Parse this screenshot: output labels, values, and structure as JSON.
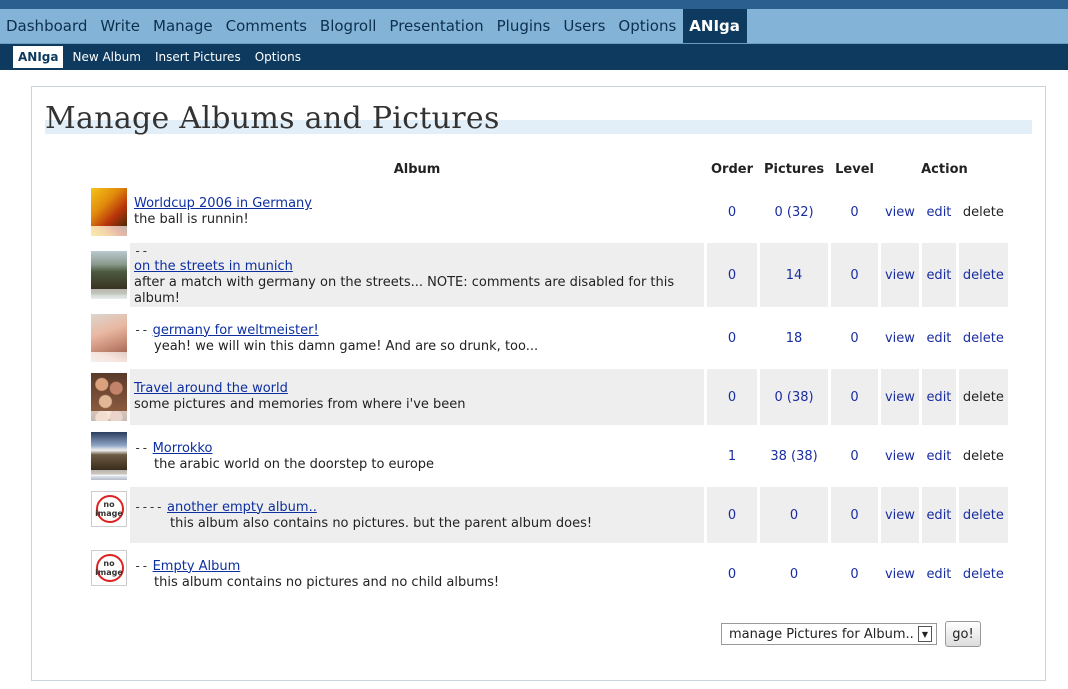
{
  "nav": {
    "main": [
      "Dashboard",
      "Write",
      "Manage",
      "Comments",
      "Blogroll",
      "Presentation",
      "Plugins",
      "Users",
      "Options",
      "ANIga"
    ],
    "sub": [
      "ANIga",
      "New Album",
      "Insert Pictures",
      "Options"
    ]
  },
  "page": {
    "title": "Manage Albums and Pictures"
  },
  "table": {
    "headers": {
      "album": "Album",
      "order": "Order",
      "pictures": "Pictures",
      "level": "Level",
      "action": "Action"
    },
    "rows": [
      {
        "prefix": "",
        "name": "Worldcup 2006 in Germany",
        "desc": "the ball is runnin!",
        "order": "0",
        "pictures": "0 (32)",
        "level": "0",
        "view": "view",
        "edit": "edit",
        "delete": "delete",
        "thumb": "football-photo"
      },
      {
        "prefix": "--",
        "name": "on the streets in munich",
        "desc": "after a match with germany on the streets... NOTE: comments are disabled for this album!",
        "order": "0",
        "pictures": "14",
        "level": "0",
        "view": "view",
        "edit": "edit",
        "delete": "delete",
        "thumb": "street-photo"
      },
      {
        "prefix": "--",
        "name": "germany for weltmeister!",
        "desc": "yeah! we will win this damn game! And are so drunk, too...",
        "order": "0",
        "pictures": "18",
        "level": "0",
        "view": "view",
        "edit": "edit",
        "delete": "delete",
        "thumb": "hand-photo"
      },
      {
        "prefix": "",
        "name": "Travel around the world",
        "desc": "some pictures and memories from where i've been",
        "order": "0",
        "pictures": "0 (38)",
        "level": "0",
        "view": "view",
        "edit": "edit",
        "delete": "delete",
        "thumb": "crowd-photo"
      },
      {
        "prefix": "--",
        "name": "Morrokko",
        "desc": "the arabic world on the doorstep to europe",
        "order": "1",
        "pictures": "38 (38)",
        "level": "0",
        "view": "view",
        "edit": "edit",
        "delete": "delete",
        "thumb": "landscape-photo"
      },
      {
        "prefix": "----",
        "name": "another empty album..",
        "desc": "this album also contains no pictures. but the parent album does!",
        "order": "0",
        "pictures": "0",
        "level": "0",
        "view": "view",
        "edit": "edit",
        "delete": "delete",
        "thumb": "no-image-icon"
      },
      {
        "prefix": "--",
        "name": "Empty Album",
        "desc": "this album contains no pictures and no child albums!",
        "order": "0",
        "pictures": "0",
        "level": "0",
        "view": "view",
        "edit": "edit",
        "delete": "delete",
        "thumb": "no-image-icon"
      }
    ],
    "noimage_text": "no image"
  },
  "footer": {
    "select_value": "manage Pictures for Album..",
    "go_label": "go!"
  },
  "colors": {
    "link": "#0d2fa0",
    "nav_bg": "#83b4d8",
    "nav_active": "#0d3a5e",
    "row_alt": "#eeeeee"
  }
}
